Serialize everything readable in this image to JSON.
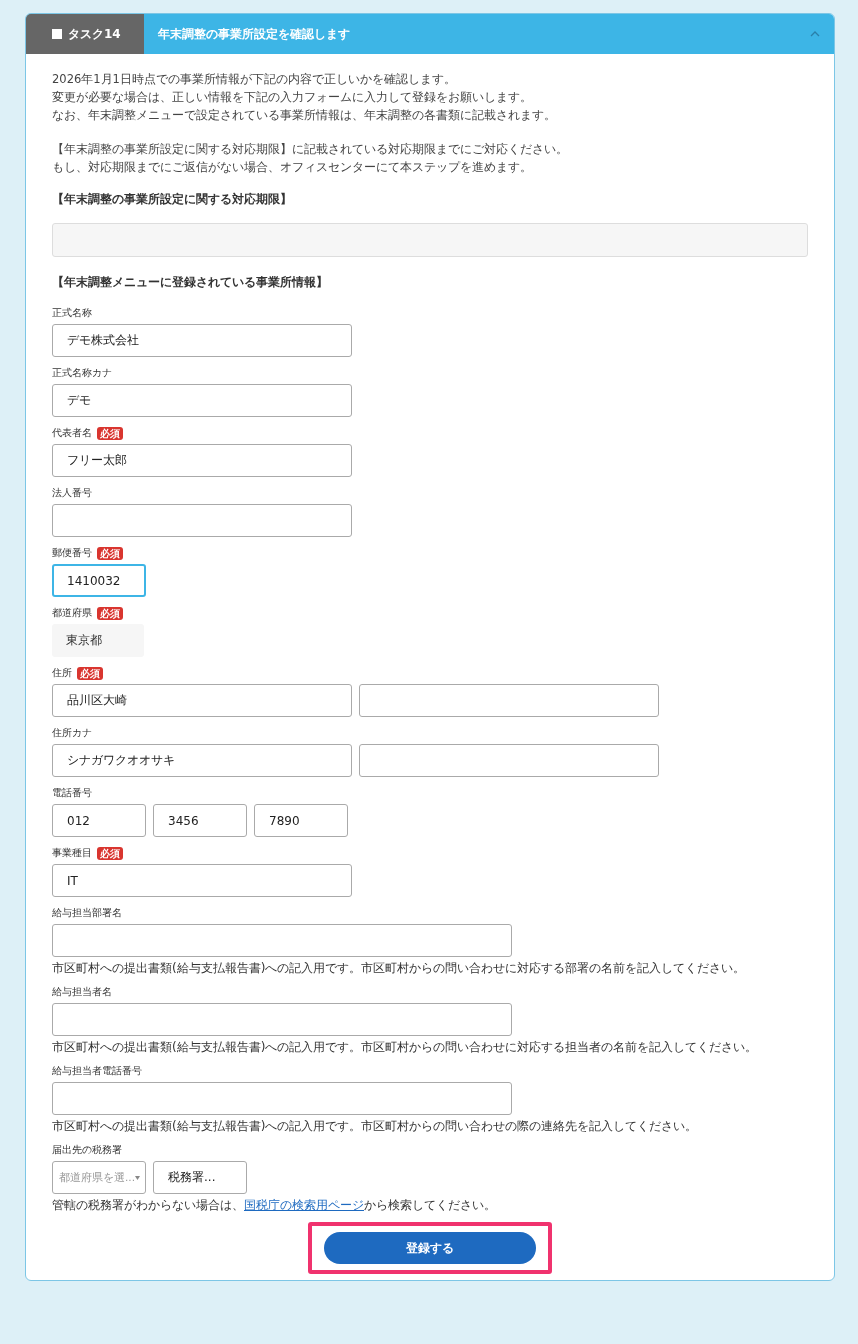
{
  "task": {
    "badge": "タスク14",
    "title": "年末調整の事業所設定を確認します",
    "expanded": true
  },
  "intro": [
    [
      "2026年1月1日時点での事業所情報が下記の内容で正しいかを確認します。",
      "変更が必要な場合は、正しい情報を下記の入力フォームに入力して登録をお願いします。",
      "なお、年末調整メニューで設定されている事業所情報は、年末調整の各書類に記載されます。"
    ],
    [
      "【年末調整の事業所設定に関する対応期限】に記載されている対応期限までにご対応ください。",
      "もし、対応期限までにご返信がない場合、オフィスセンターにて本ステップを進めます。"
    ]
  ],
  "deadline": {
    "heading": "【年末調整の事業所設定に関する対応期限】"
  },
  "section": {
    "heading": "【年末調整メニューに登録されている事業所情報】"
  },
  "fields": [
    {
      "label": "正式名称",
      "inputs": [
        {
          "kind": "text",
          "value": "デモ株式会社",
          "focused": false
        }
      ]
    },
    {
      "label": "正式名称カナ",
      "inputs": [
        {
          "kind": "text",
          "value": "デモ",
          "focused": false
        }
      ]
    },
    {
      "label": "代表者名",
      "required_badge": "必須",
      "inputs": [
        {
          "kind": "text",
          "value": "フリー太郎",
          "focused": false
        }
      ]
    },
    {
      "label": "法人番号",
      "inputs": [
        {
          "kind": "text",
          "focused": false
        }
      ]
    },
    {
      "label": "郵便番号",
      "required_badge": "必須",
      "inputs": [
        {
          "kind": "short",
          "value": "1410032",
          "focused": true
        }
      ]
    },
    {
      "label": "都道府県",
      "required_badge": "必須",
      "inputs": [
        {
          "kind": "static",
          "value": "東京都"
        }
      ]
    },
    {
      "label": "住所",
      "required_badge": "必須",
      "inputs": [
        {
          "kind": "text",
          "value": "品川区大崎",
          "focused": false
        },
        {
          "kind": "text",
          "focused": false
        }
      ]
    },
    {
      "label": "住所カナ",
      "inputs": [
        {
          "kind": "text",
          "value": "シナガワクオオサキ",
          "focused": false
        },
        {
          "kind": "text",
          "focused": false
        }
      ]
    },
    {
      "label": "電話番号",
      "inputs": [
        {
          "kind": "short",
          "value": "012",
          "focused": false
        },
        {
          "kind": "short",
          "value": "3456",
          "focused": false
        },
        {
          "kind": "short",
          "value": "7890",
          "focused": false
        }
      ]
    },
    {
      "label": "事業種目",
      "required_badge": "必須",
      "inputs": [
        {
          "kind": "text",
          "value": "IT",
          "focused": false
        }
      ]
    },
    {
      "label": "給与担当部署名",
      "inputs": [
        {
          "kind": "wide",
          "focused": false
        }
      ],
      "hint": {
        "text": "市区町村への提出書類(給与支払報告書)への記入用です。市区町村からの問い合わせに対応する部署の名前を記入してください。"
      }
    },
    {
      "label": "給与担当者名",
      "inputs": [
        {
          "kind": "wide",
          "focused": false
        }
      ],
      "hint": {
        "text": "市区町村への提出書類(給与支払報告書)への記入用です。市区町村からの問い合わせに対応する担当者の名前を記入してください。"
      }
    },
    {
      "label": "給与担当者電話番号",
      "inputs": [
        {
          "kind": "wide",
          "focused": false
        }
      ],
      "hint": {
        "text": "市区町村への提出書類(給与支払報告書)への記入用です。市区町村からの問い合わせの際の連絡先を記入してください。"
      }
    },
    {
      "label": "届出先の税務署",
      "inputs": [
        {
          "kind": "select",
          "placeholder": "都道府県を選..."
        },
        {
          "kind": "short",
          "value": "税務署...",
          "focused": false
        }
      ],
      "hint": {
        "text": "管轄の税務署がわからない場合は、",
        "link": "国税庁の検索用ページ",
        "after": "から検索してください。"
      }
    }
  ],
  "submit": {
    "label": "登録する",
    "highlighted": true
  }
}
